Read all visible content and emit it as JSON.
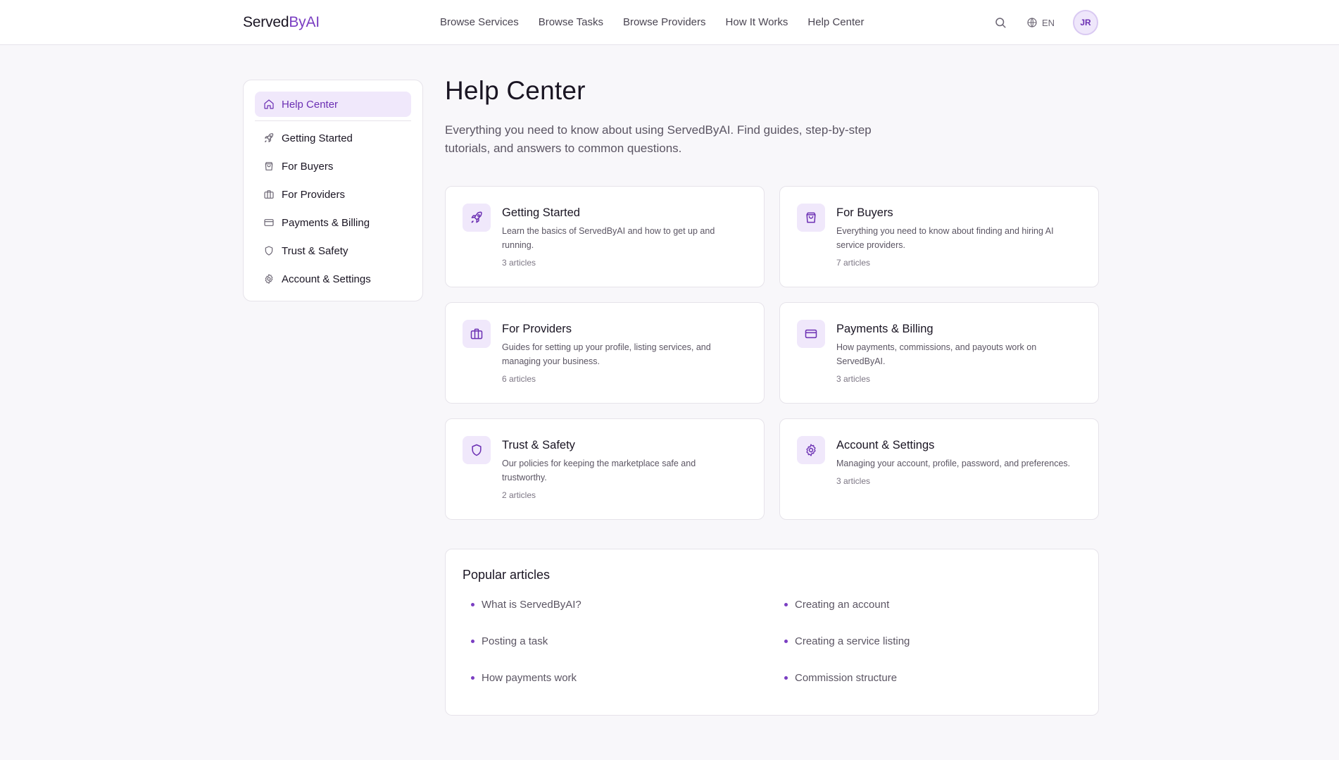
{
  "header": {
    "logo_part1": "Served",
    "logo_part2": "ByAI",
    "nav": [
      {
        "label": "Browse Services"
      },
      {
        "label": "Browse Tasks"
      },
      {
        "label": "Browse Providers"
      },
      {
        "label": "How It Works"
      },
      {
        "label": "Help Center"
      }
    ],
    "search_icon": "search-icon",
    "language": "EN",
    "language_icon": "globe-icon",
    "avatar_initials": "JR"
  },
  "sidebar": {
    "items": [
      {
        "label": "Help Center",
        "icon": "home-icon"
      },
      {
        "label": "Getting Started",
        "icon": "rocket-icon"
      },
      {
        "label": "For Buyers",
        "icon": "shopping-bag-icon"
      },
      {
        "label": "For Providers",
        "icon": "briefcase-icon"
      },
      {
        "label": "Payments & Billing",
        "icon": "credit-card-icon"
      },
      {
        "label": "Trust & Safety",
        "icon": "shield-icon"
      },
      {
        "label": "Account & Settings",
        "icon": "gear-icon"
      }
    ]
  },
  "main": {
    "title": "Help Center",
    "subtitle": "Everything you need to know about using ServedByAI. Find guides, step-by-step tutorials, and answers to common questions.",
    "categories": [
      {
        "title": "Getting Started",
        "description": "Learn the basics of ServedByAI and how to get up and running.",
        "count": "3 articles",
        "icon": "rocket-icon"
      },
      {
        "title": "For Buyers",
        "description": "Everything you need to know about finding and hiring AI service providers.",
        "count": "7 articles",
        "icon": "shopping-bag-icon"
      },
      {
        "title": "For Providers",
        "description": "Guides for setting up your profile, listing services, and managing your business.",
        "count": "6 articles",
        "icon": "briefcase-icon"
      },
      {
        "title": "Payments & Billing",
        "description": "How payments, commissions, and payouts work on ServedByAI.",
        "count": "3 articles",
        "icon": "credit-card-icon"
      },
      {
        "title": "Trust & Safety",
        "description": "Our policies for keeping the marketplace safe and trustworthy.",
        "count": "2 articles",
        "icon": "shield-icon"
      },
      {
        "title": "Account & Settings",
        "description": "Managing your account, profile, password, and preferences.",
        "count": "3 articles",
        "icon": "gear-icon"
      }
    ],
    "popular": {
      "title": "Popular articles",
      "items": [
        {
          "label": "What is ServedByAI?"
        },
        {
          "label": "Creating an account"
        },
        {
          "label": "Posting a task"
        },
        {
          "label": "Creating a service listing"
        },
        {
          "label": "How payments work"
        },
        {
          "label": "Commission structure"
        }
      ]
    }
  },
  "colors": {
    "accent": "#7a3ec2",
    "accent_light": "#f0e8fb",
    "background": "#f8f7fa",
    "border": "#e6e3ea"
  }
}
